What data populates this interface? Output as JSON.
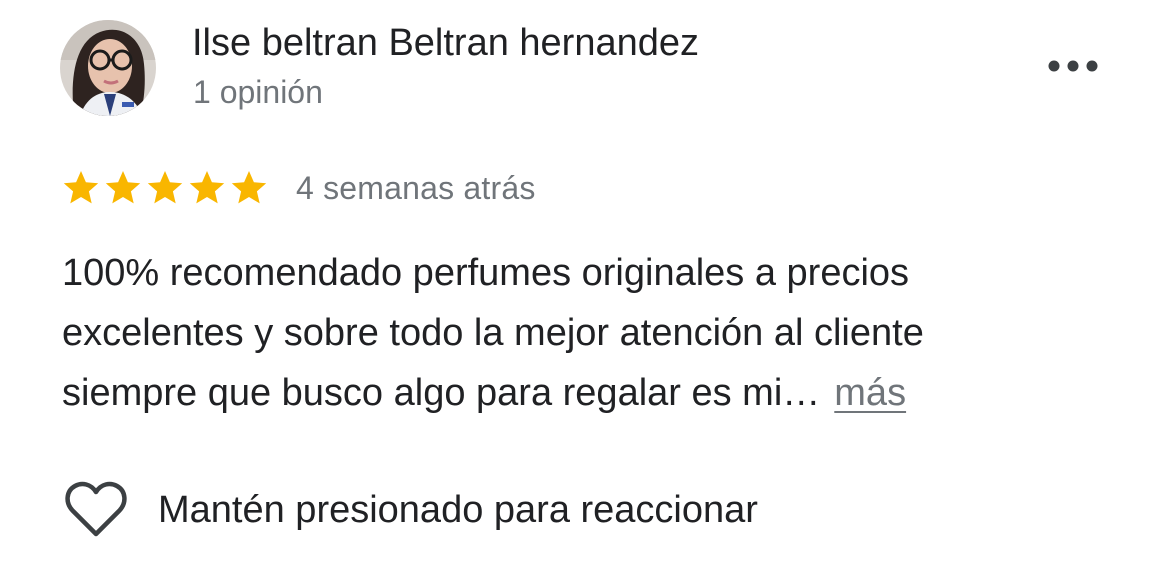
{
  "review": {
    "author_name": "Ilse beltran Beltran hernandez",
    "author_meta": "1 opinión",
    "rating": 5,
    "rating_max": 5,
    "time_ago": "4 semanas atrás",
    "text": "100% recomendado perfumes originales a precios\nexcelentes y sobre todo la mejor atención  al cliente\nsiempre que busco algo para regalar es mi…",
    "more_label": "más",
    "reaction_label": "Mantén presionado para reaccionar"
  },
  "colors": {
    "star": "#f9b600",
    "name": "#202124",
    "secondary": "#70757a",
    "icon": "#3c4043"
  },
  "icons": {
    "menu": "more-horizontal-icon",
    "reaction": "heart-outline-icon"
  }
}
